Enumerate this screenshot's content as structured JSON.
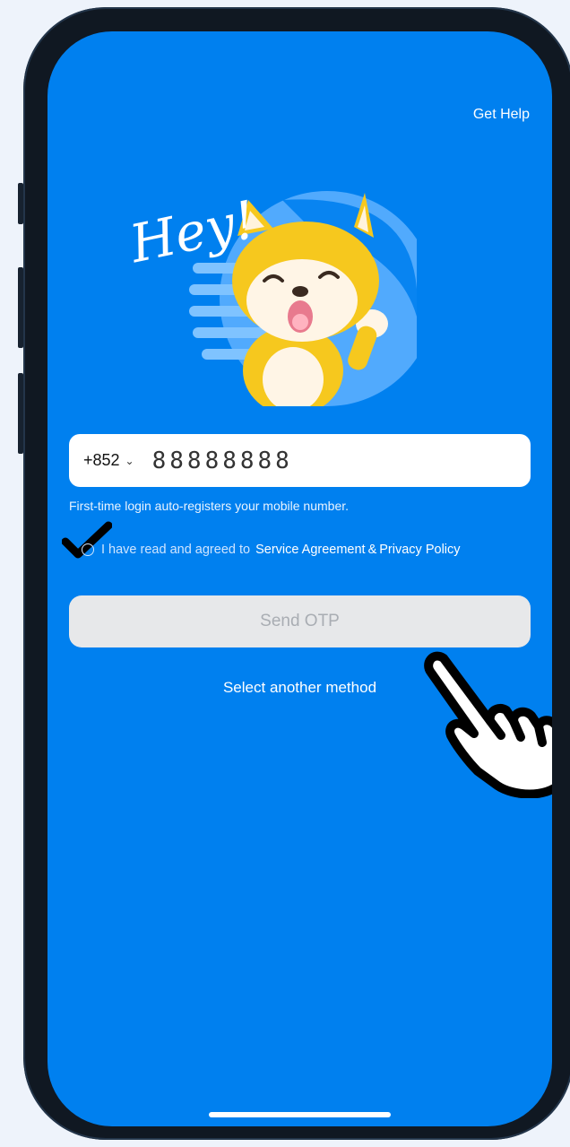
{
  "header": {
    "get_help": "Get Help"
  },
  "hero": {
    "greeting": "Hey!",
    "mascot": "shiba-mascot"
  },
  "login": {
    "country_code": "+852",
    "phone_value": "88888888",
    "hint": "First-time login auto-registers your mobile number.",
    "agree_prefix": "I have read and agreed to",
    "service_agreement": "Service Agreement",
    "amp": "&",
    "privacy_policy": "Privacy Policy",
    "agreement_checked": true,
    "send_otp_label": "Send OTP",
    "send_otp_enabled": false,
    "alt_method": "Select another method"
  },
  "overlay": {
    "pointer": "pointing-hand-icon"
  },
  "colors": {
    "background": "#0080ef",
    "button_disabled": "#e7e8ea",
    "button_text_disabled": "#a9adb3"
  }
}
